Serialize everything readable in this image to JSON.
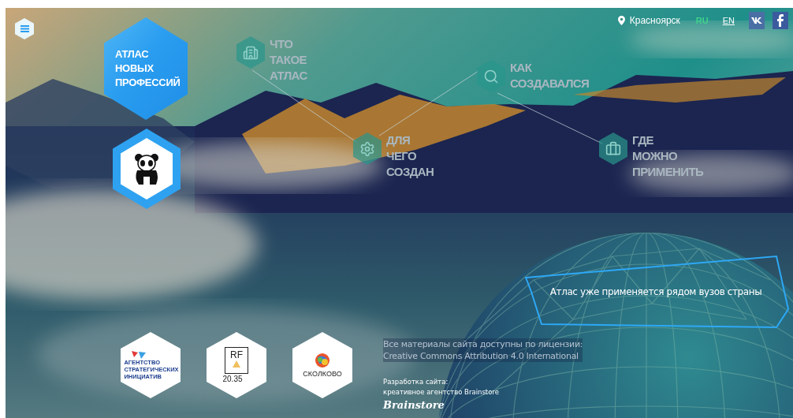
{
  "logo": {
    "lines": [
      "АТЛАС",
      "НОВЫХ",
      "ПРОФЕССИЙ"
    ]
  },
  "header": {
    "location": "Красноярск",
    "languages": [
      {
        "label": "RU",
        "selected": true
      },
      {
        "label": "EN",
        "selected": false
      }
    ]
  },
  "nav": [
    {
      "kind": "what",
      "lines": [
        "ЧТО",
        "ТАКОЕ",
        "АТЛАС"
      ]
    },
    {
      "kind": "how",
      "lines": [
        "КАК",
        "СОЗДАВАЛСЯ"
      ]
    },
    {
      "kind": "why",
      "lines": [
        "ДЛЯ",
        "ЧЕГО",
        "СОЗДАН"
      ]
    },
    {
      "kind": "where",
      "lines": [
        "ГДЕ",
        "МОЖНО",
        "ПРИМЕНИТЬ"
      ]
    }
  ],
  "dome_caption": "Атлас уже применяется рядом вузов страны",
  "partners": [
    {
      "kind": "asi",
      "lines": [
        "АГЕНТСТВО",
        "СТРАТЕГИЧЕСКИХ",
        "ИНИЦИАТИВ"
      ]
    },
    {
      "kind": "rf",
      "lines": [
        "RF",
        "20.35"
      ]
    },
    {
      "kind": "skolkovo",
      "lines": [
        "СКОЛКОВО"
      ]
    }
  ],
  "footer": {
    "license": [
      "Все материалы сайта доступны по лицензии:",
      "Creative Commons Attribution 4.0 International"
    ],
    "credits": [
      "Разработка сайта:",
      "креативное агентство Brainstore"
    ],
    "agency_logo": "Brainstore"
  }
}
